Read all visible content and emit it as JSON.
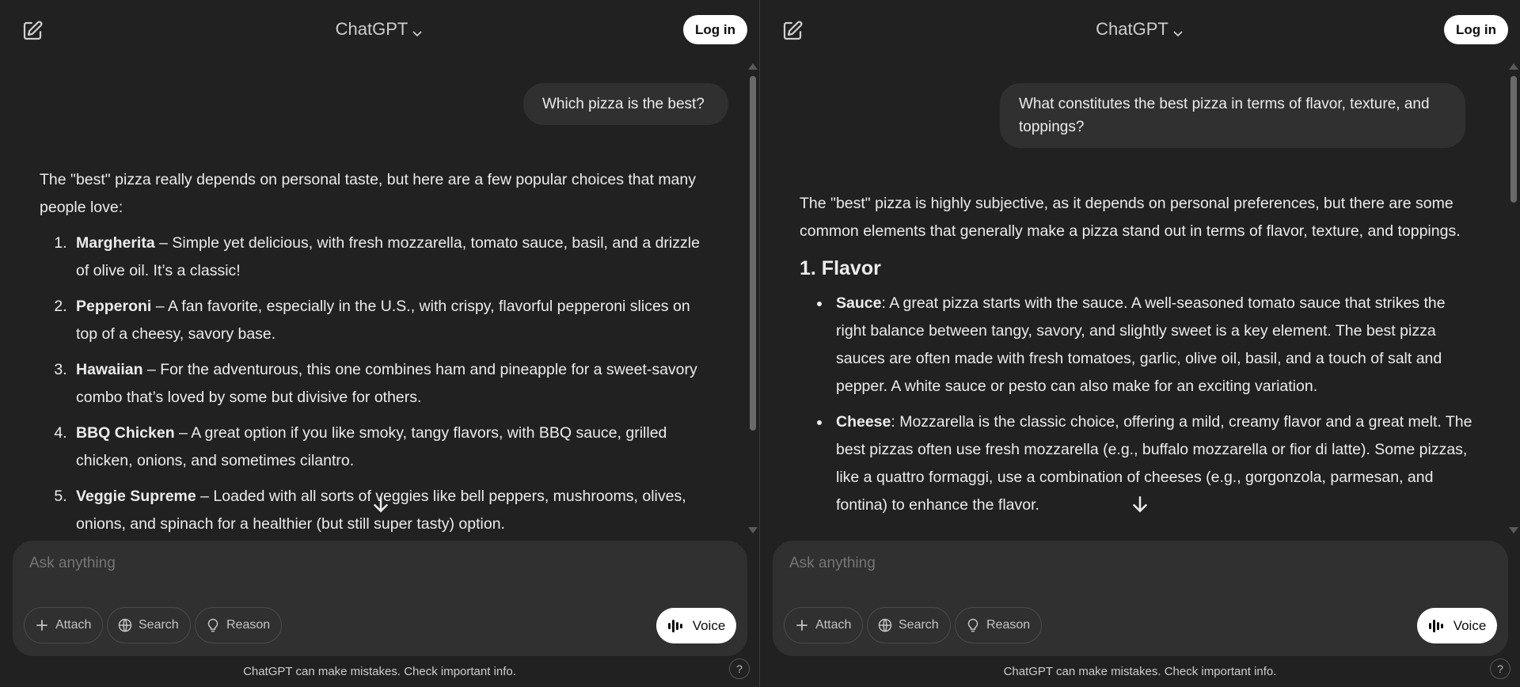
{
  "panes": [
    {
      "title": "ChatGPT",
      "login_label": "Log in",
      "user_message": "Which pizza is the best?",
      "assistant": {
        "intro": "The \"best\" pizza really depends on personal taste, but here are a few popular choices that many people love:",
        "items": [
          {
            "name": "Margherita",
            "text": " – Simple yet delicious, with fresh mozzarella, tomato sauce, basil, and a drizzle of olive oil. It’s a classic!"
          },
          {
            "name": "Pepperoni",
            "text": " – A fan favorite, especially in the U.S., with crispy, flavorful pepperoni slices on top of a cheesy, savory base."
          },
          {
            "name": "Hawaiian",
            "text": " – For the adventurous, this one combines ham and pineapple for a sweet-savory combo that’s loved by some but divisive for others."
          },
          {
            "name": "BBQ Chicken",
            "text": " – A great option if you like smoky, tangy flavors, with BBQ sauce, grilled chicken, onions, and sometimes cilantro."
          },
          {
            "name": "Veggie Supreme",
            "text": " – Loaded with all sorts of veggies like bell peppers, mushrooms, olives, onions, and spinach for a healthier (but still super tasty) option."
          }
        ]
      },
      "composer": {
        "placeholder": "Ask anything",
        "attach": "Attach",
        "search": "Search",
        "reason": "Reason",
        "voice": "Voice"
      },
      "disclaimer": "ChatGPT can make mistakes. Check important info.",
      "help": "?"
    },
    {
      "title": "ChatGPT",
      "login_label": "Log in",
      "user_message": "What constitutes the best pizza in terms of flavor, texture, and toppings?",
      "assistant": {
        "intro": "The \"best\" pizza is highly subjective, as it depends on personal preferences, but there are some common elements that generally make a pizza stand out in terms of flavor, texture, and toppings.",
        "heading": "1. Flavor",
        "items": [
          {
            "name": "Sauce",
            "text": ": A great pizza starts with the sauce. A well-seasoned tomato sauce that strikes the right balance between tangy, savory, and slightly sweet is a key element. The best pizza sauces are often made with fresh tomatoes, garlic, olive oil, basil, and a touch of salt and pepper. A white sauce or pesto can also make for an exciting variation."
          },
          {
            "name": "Cheese",
            "text": ": Mozzarella is the classic choice, offering a mild, creamy flavor and a great melt. The best pizzas often use fresh mozzarella (e.g., buffalo mozzarella or fior di latte). Some pizzas, like a quattro formaggi, use a combination of cheeses (e.g., gorgonzola, parmesan, and fontina) to enhance the flavor."
          }
        ]
      },
      "composer": {
        "placeholder": "Ask anything",
        "attach": "Attach",
        "search": "Search",
        "reason": "Reason",
        "voice": "Voice"
      },
      "disclaimer": "ChatGPT can make mistakes. Check important info.",
      "help": "?"
    }
  ]
}
